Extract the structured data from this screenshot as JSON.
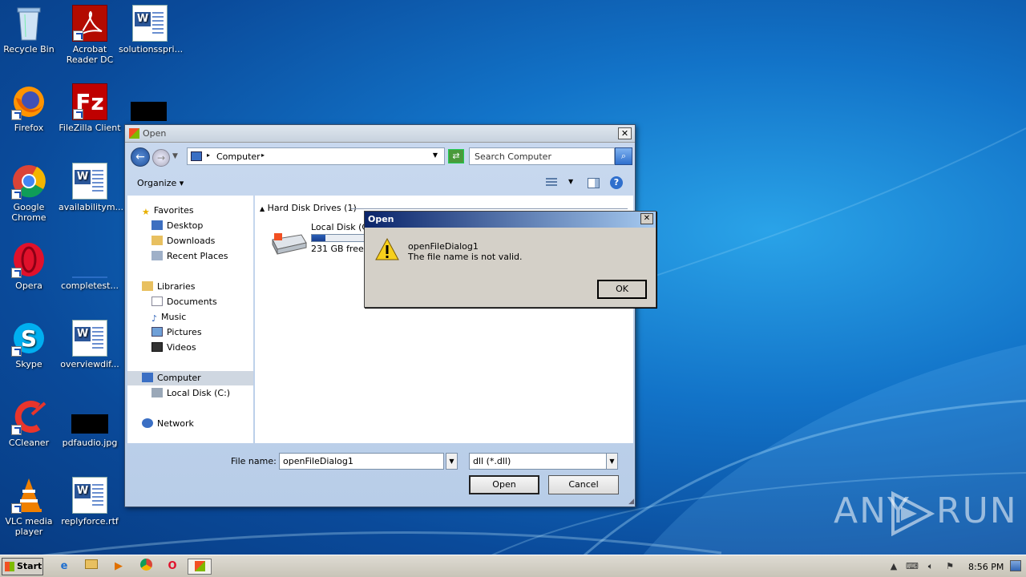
{
  "desktop": {
    "icons": [
      {
        "label": "Recycle Bin"
      },
      {
        "label": "Acrobat Reader DC"
      },
      {
        "label": "solutionsspri..."
      },
      {
        "label": "Firefox"
      },
      {
        "label": "FileZilla Client"
      },
      {
        "label": "Google Chrome"
      },
      {
        "label": "availabilitym..."
      },
      {
        "label": "Opera"
      },
      {
        "label": "completest..."
      },
      {
        "label": "Skype"
      },
      {
        "label": "overviewdif..."
      },
      {
        "label": "CCleaner"
      },
      {
        "label": "pdfaudio.jpg"
      },
      {
        "label": "VLC media player"
      },
      {
        "label": "replyforce.rtf"
      }
    ]
  },
  "open_dialog": {
    "title": "Open",
    "address": {
      "location": "Computer"
    },
    "search_placeholder": "Search Computer",
    "toolbar": {
      "organize": "Organize"
    },
    "nav": {
      "favorites": "Favorites",
      "desktop": "Desktop",
      "downloads": "Downloads",
      "recent": "Recent Places",
      "libraries": "Libraries",
      "documents": "Documents",
      "music": "Music",
      "pictures": "Pictures",
      "videos": "Videos",
      "computer": "Computer",
      "local_disk": "Local Disk (C:)",
      "network": "Network"
    },
    "content": {
      "group_header": "Hard Disk Drives (1)",
      "drive_name": "Local Disk (C:)",
      "drive_free": "231 GB free o",
      "drive_used_fraction": 0.22
    },
    "file_name_label": "File name:",
    "file_name_value": "openFileDialog1",
    "file_type_value": "dll (*.dll)",
    "open_button": "Open",
    "cancel_button": "Cancel"
  },
  "message_box": {
    "title": "Open",
    "line1": "openFileDialog1",
    "line2": "The file name is not valid.",
    "ok_button": "OK"
  },
  "taskbar": {
    "start": "Start",
    "clock": "8:56 PM"
  },
  "watermark": {
    "text_left": "ANY",
    "text_right": "RUN"
  }
}
